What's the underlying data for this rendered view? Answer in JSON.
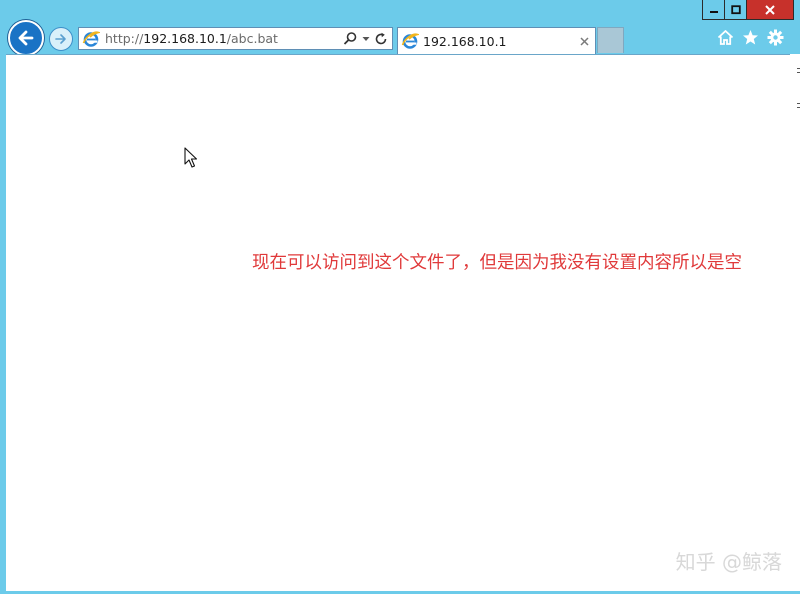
{
  "browser": {
    "address_bar": {
      "url_prefix": "http://",
      "url_host": "192.168.10.1",
      "url_path": "/abc.bat"
    },
    "tab": {
      "title": "192.168.10.1",
      "close_glyph": "×"
    },
    "icons": {
      "back": "back-arrow-icon",
      "forward": "forward-arrow-icon",
      "page": "ie-logo-icon",
      "search": "search-icon",
      "dropdown": "chevron-down-icon",
      "refresh": "refresh-icon",
      "home": "home-icon",
      "favorites": "star-icon",
      "settings": "gear-icon",
      "minimize": "minimize-icon",
      "maximize": "maximize-icon",
      "close": "close-icon"
    }
  },
  "content": {
    "annotation": "现在可以访问到这个文件了，但是因为我没有设置内容所以是空",
    "watermark": "知乎 @鲸落"
  },
  "colors": {
    "frame": "#6ccbea",
    "annotation": "#e0393a",
    "close_button": "#c7312b",
    "back_button": "#1a73c5"
  }
}
